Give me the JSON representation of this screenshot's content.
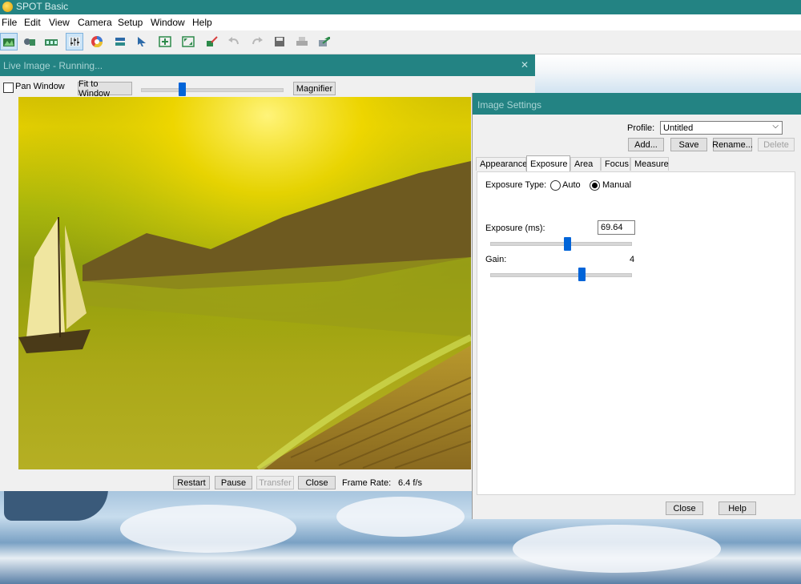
{
  "app": {
    "title": "SPOT Basic"
  },
  "menu": [
    "File",
    "Edit",
    "View",
    "Camera",
    "Setup",
    "Window",
    "Help"
  ],
  "toolbar": {
    "icons": [
      "live-image-icon",
      "camera-capture-icon",
      "filmstrip-icon",
      "image-settings-icon",
      "color-wheel-icon",
      "layers-icon",
      "pointer-icon",
      "zoom-in-icon",
      "fit-icon",
      "edit-brush-icon",
      "undo-icon",
      "redo-icon",
      "save-icon",
      "print-icon",
      "export-icon"
    ]
  },
  "live_window": {
    "title": "Live Image - Running...",
    "pan_window_label": "Pan Window",
    "pan_window_checked": false,
    "fit_button": "Fit to Window",
    "magnifier_button": "Magnifier",
    "zoom_slider_level": 0.29,
    "buttons": {
      "restart": "Restart",
      "pause": "Pause",
      "transfer": "Transfer",
      "close": "Close"
    },
    "frame_rate_label": "Frame Rate:",
    "frame_rate_value": "6.4 f/s"
  },
  "settings_dialog": {
    "title": "Image Settings",
    "profile_label": "Profile:",
    "profile_value": "Untitled",
    "buttons": {
      "add": "Add...",
      "save": "Save",
      "rename": "Rename...",
      "delete": "Delete",
      "close": "Close",
      "help": "Help"
    },
    "tabs": [
      "Appearance",
      "Exposure",
      "Area",
      "Focus",
      "Measure"
    ],
    "active_tab": "Exposure",
    "exposure_type_label": "Exposure Type:",
    "exposure_auto": "Auto",
    "exposure_manual": "Manual",
    "exposure_mode": "Manual",
    "exposure_label": "Exposure (ms):",
    "exposure_value": "69.64",
    "exposure_slider_level": 0.55,
    "gain_label": "Gain:",
    "gain_value": "4",
    "gain_slider_level": 0.65
  },
  "colors": {
    "titlebar": "#238383",
    "slider_thumb": "#0064d8"
  }
}
